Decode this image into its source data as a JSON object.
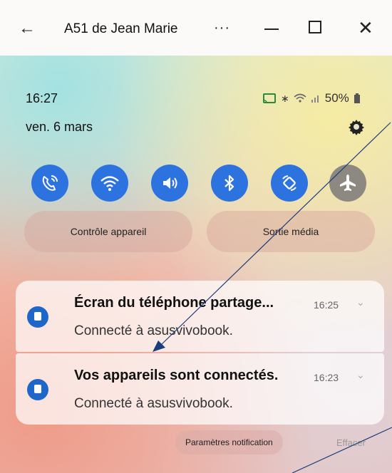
{
  "window": {
    "title": "A51 de Jean Marie",
    "more_label": "···"
  },
  "phone": {
    "time": "16:27",
    "date": "ven. 6 mars",
    "battery": "50%"
  },
  "quick_settings": [
    {
      "name": "wifi-calling-icon",
      "state": "on"
    },
    {
      "name": "wifi-icon",
      "state": "on"
    },
    {
      "name": "sound-icon",
      "state": "on"
    },
    {
      "name": "bluetooth-icon",
      "state": "on"
    },
    {
      "name": "auto-rotate-icon",
      "state": "on"
    },
    {
      "name": "airplane-mode-icon",
      "state": "off"
    }
  ],
  "buttons": {
    "device_control": "Contrôle appareil",
    "media_output": "Sortie média"
  },
  "notifications": [
    {
      "title": "Écran du téléphone partage...",
      "time": "16:25",
      "text": "Connecté à asusvivobook."
    },
    {
      "title": "Vos appareils sont connectés.",
      "time": "16:23",
      "text": "Connecté à asusvivobook."
    }
  ],
  "footer": {
    "notification_settings": "Paramètres notification",
    "clear": "Effacer"
  },
  "colors": {
    "accent": "#2d73e0",
    "off_toggle": "#8d8880",
    "annotation_line": "#1a3d7c"
  }
}
